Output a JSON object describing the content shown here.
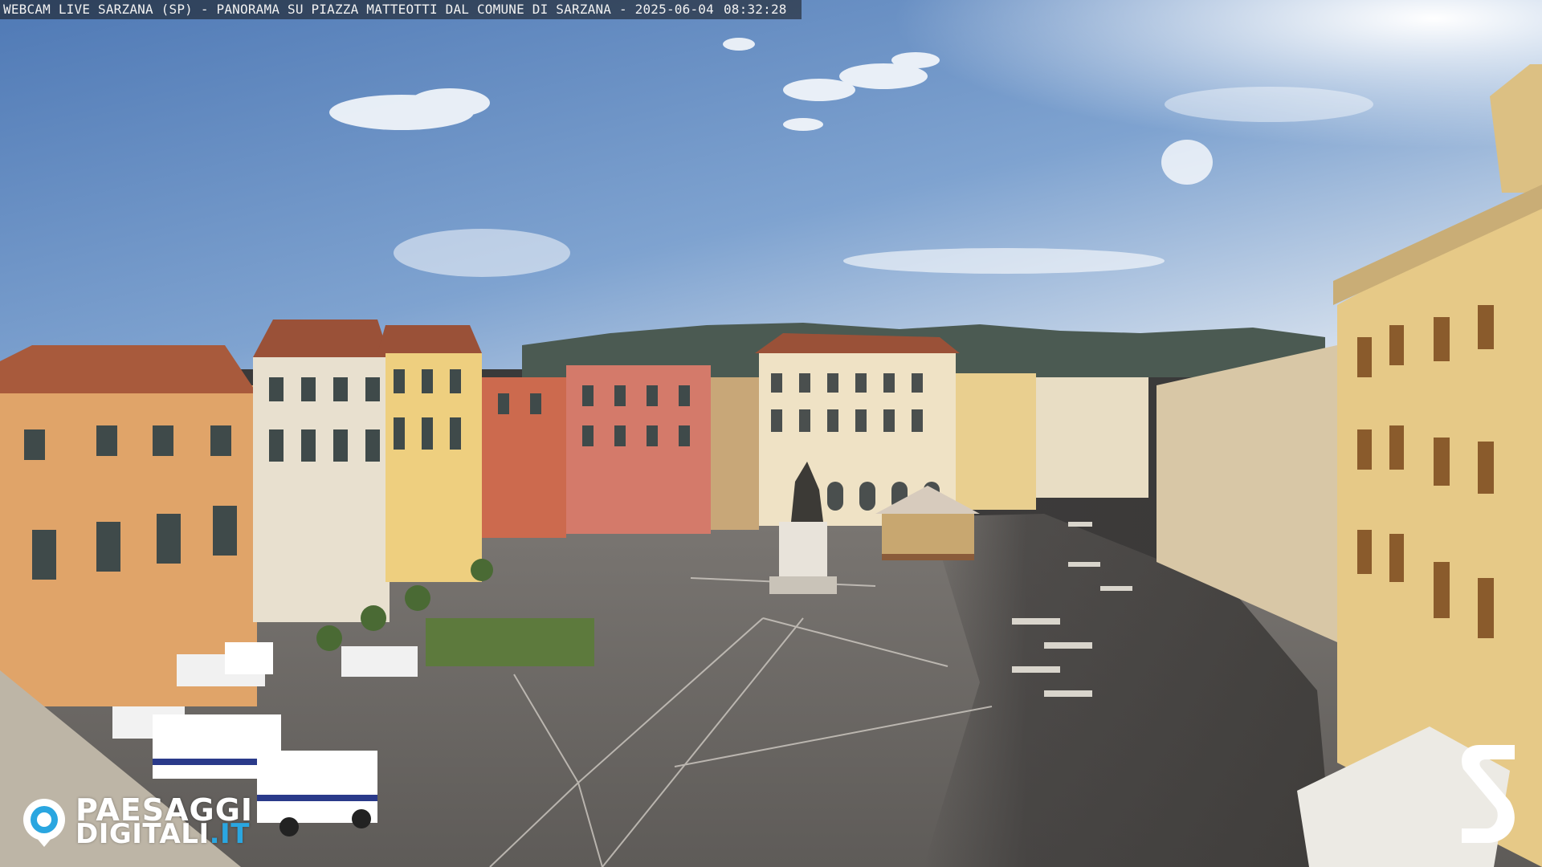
{
  "overlay": {
    "caption_title": "WEBCAM LIVE SARZANA (SP) - PANORAMA SU PIAZZA MATTEOTTI DAL COMUNE DI SARZANA -",
    "caption_date": "2025-06-04",
    "caption_time": "08:32:28"
  },
  "watermark": {
    "line1": "PAESAGGI",
    "line2_main": "DIGITALI",
    "line2_accent": ".IT",
    "icon": "camera-lens-icon",
    "accent_color": "#2aa6e0"
  },
  "corner_logo": {
    "icon": "stylized-s-logo-icon",
    "color": "#ffffff"
  },
  "scene": {
    "sky_color": "#6f95c8",
    "pavement_color": "#6b6864"
  }
}
